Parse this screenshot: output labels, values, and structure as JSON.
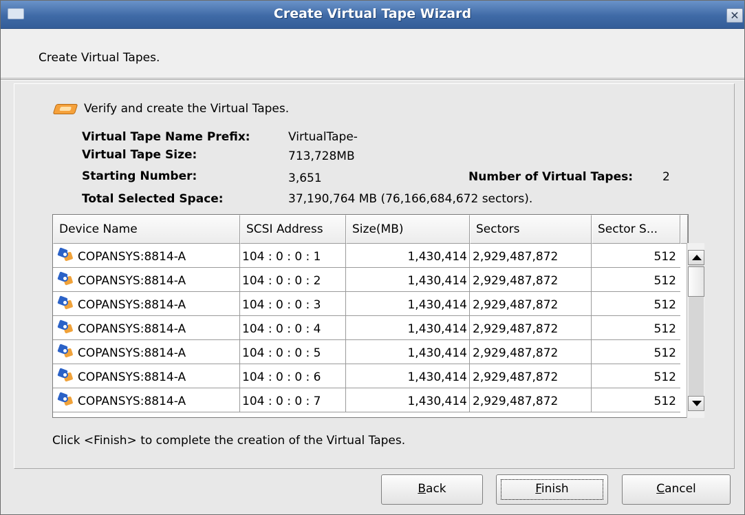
{
  "window": {
    "title": "Create Virtual Tape Wizard"
  },
  "header": {
    "text": "Create Virtual Tapes."
  },
  "main": {
    "verify_text": "Verify and create the Virtual Tapes.",
    "fields": {
      "prefix_label": "Virtual Tape Name Prefix:",
      "prefix_value": "VirtualTape-",
      "size_label": "Virtual Tape Size:",
      "size_value": "713,728MB",
      "start_label": "Starting Number:",
      "start_value": "3,651",
      "count_label": "Number of Virtual Tapes:",
      "count_value": "2",
      "total_label": "Total Selected Space:",
      "total_value": "37,190,764 MB (76,166,684,672 sectors)."
    },
    "table": {
      "columns": [
        "Device Name",
        "SCSI Address",
        "Size(MB)",
        "Sectors",
        "Sector S..."
      ],
      "rows": [
        {
          "device": "COPANSYS:8814-A",
          "scsi": "104 : 0 : 0 : 1",
          "size": "1,430,414",
          "sectors": "2,929,487,872",
          "sector_size": "512"
        },
        {
          "device": "COPANSYS:8814-A",
          "scsi": "104 : 0 : 0 : 2",
          "size": "1,430,414",
          "sectors": "2,929,487,872",
          "sector_size": "512"
        },
        {
          "device": "COPANSYS:8814-A",
          "scsi": "104 : 0 : 0 : 3",
          "size": "1,430,414",
          "sectors": "2,929,487,872",
          "sector_size": "512"
        },
        {
          "device": "COPANSYS:8814-A",
          "scsi": "104 : 0 : 0 : 4",
          "size": "1,430,414",
          "sectors": "2,929,487,872",
          "sector_size": "512"
        },
        {
          "device": "COPANSYS:8814-A",
          "scsi": "104 : 0 : 0 : 5",
          "size": "1,430,414",
          "sectors": "2,929,487,872",
          "sector_size": "512"
        },
        {
          "device": "COPANSYS:8814-A",
          "scsi": "104 : 0 : 0 : 6",
          "size": "1,430,414",
          "sectors": "2,929,487,872",
          "sector_size": "512"
        },
        {
          "device": "COPANSYS:8814-A",
          "scsi": "104 : 0 : 0 : 7",
          "size": "1,430,414",
          "sectors": "2,929,487,872",
          "sector_size": "512"
        }
      ]
    },
    "footer_text": "Click <Finish> to complete the creation of the Virtual Tapes."
  },
  "buttons": {
    "back": {
      "pre": "",
      "mnemonic": "B",
      "post": "ack"
    },
    "finish": {
      "pre": "",
      "mnemonic": "F",
      "post": "inish"
    },
    "cancel": {
      "pre": "",
      "mnemonic": "C",
      "post": "ancel"
    }
  },
  "icons": {
    "window_menu": "window-menu-icon",
    "close": "close-icon",
    "tape": "virtual-tape-icon",
    "device": "device-icon"
  }
}
